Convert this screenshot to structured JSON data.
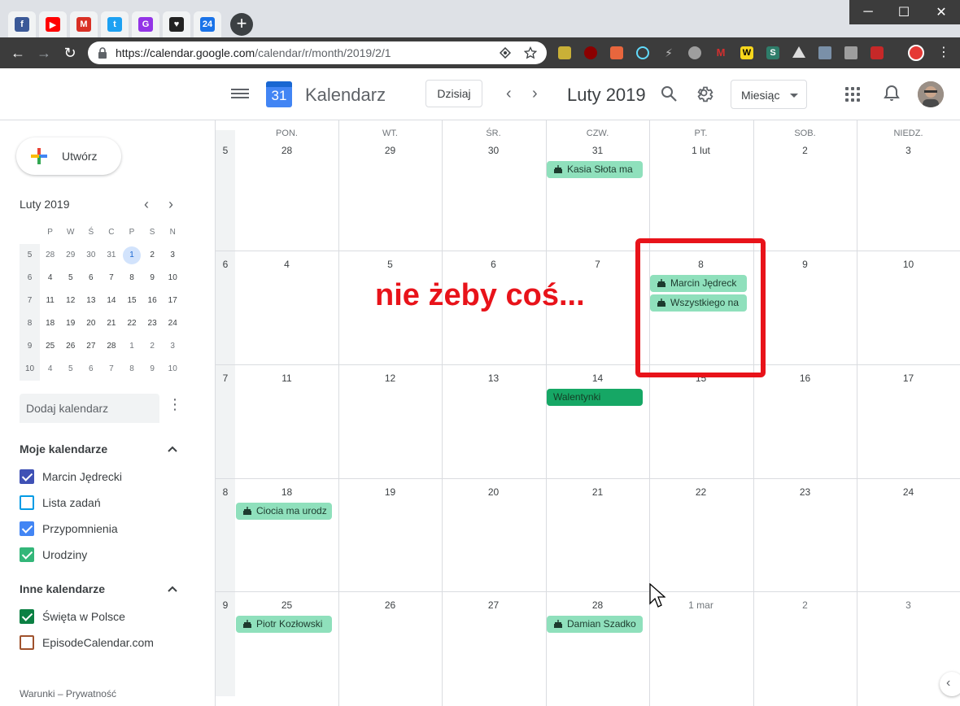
{
  "browser": {
    "tabs": [
      {
        "icon": "facebook-icon",
        "color": "#3b5998",
        "glyph": "f"
      },
      {
        "icon": "youtube-icon",
        "color": "#ff0000",
        "glyph": "▶"
      },
      {
        "icon": "gmail-icon",
        "color": "#d93025",
        "glyph": "M"
      },
      {
        "icon": "twitter-icon",
        "color": "#1da1f2",
        "glyph": "t"
      },
      {
        "icon": "grammarly-icon",
        "color": "#9334e6",
        "glyph": "G"
      },
      {
        "icon": "tv-icon",
        "color": "#222222",
        "glyph": "♥"
      },
      {
        "icon": "calendar-tab-icon",
        "color": "#1a73e8",
        "glyph": "24"
      }
    ],
    "url_host": "https://calendar.google.com",
    "url_path": "/calendar/r/month/2019/2/1"
  },
  "header": {
    "app_title": "Kalendarz",
    "logo_number": "31",
    "today_button": "Dzisiaj",
    "month_title": "Luty 2019",
    "view_select": "Miesiąc"
  },
  "sidebar": {
    "create_button": "Utwórz",
    "mini_title": "Luty 2019",
    "mini_weekdays": [
      "P",
      "W",
      "Ś",
      "C",
      "P",
      "S",
      "N"
    ],
    "mini_weeks": [
      {
        "wk": "5",
        "days": [
          [
            "28",
            true
          ],
          [
            "29",
            true
          ],
          [
            "30",
            true
          ],
          [
            "31",
            true
          ],
          [
            "1",
            false
          ],
          [
            "2",
            false
          ],
          [
            "3",
            false
          ]
        ]
      },
      {
        "wk": "6",
        "days": [
          [
            "4",
            false
          ],
          [
            "5",
            false
          ],
          [
            "6",
            false
          ],
          [
            "7",
            false
          ],
          [
            "8",
            false
          ],
          [
            "9",
            false
          ],
          [
            "10",
            false
          ]
        ]
      },
      {
        "wk": "7",
        "days": [
          [
            "11",
            false
          ],
          [
            "12",
            false
          ],
          [
            "13",
            false
          ],
          [
            "14",
            false
          ],
          [
            "15",
            false
          ],
          [
            "16",
            false
          ],
          [
            "17",
            false
          ]
        ]
      },
      {
        "wk": "8",
        "days": [
          [
            "18",
            false
          ],
          [
            "19",
            false
          ],
          [
            "20",
            false
          ],
          [
            "21",
            false
          ],
          [
            "22",
            false
          ],
          [
            "23",
            false
          ],
          [
            "24",
            false
          ]
        ]
      },
      {
        "wk": "9",
        "days": [
          [
            "25",
            false
          ],
          [
            "26",
            false
          ],
          [
            "27",
            false
          ],
          [
            "28",
            false
          ],
          [
            "1",
            true
          ],
          [
            "2",
            true
          ],
          [
            "3",
            true
          ]
        ]
      },
      {
        "wk": "10",
        "days": [
          [
            "4",
            true
          ],
          [
            "5",
            true
          ],
          [
            "6",
            true
          ],
          [
            "7",
            true
          ],
          [
            "8",
            true
          ],
          [
            "9",
            true
          ],
          [
            "10",
            true
          ]
        ]
      }
    ],
    "add_calendar_placeholder": "Dodaj kalendarz",
    "my_calendars_title": "Moje kalendarze",
    "my_calendars": [
      {
        "label": "Marcin Jędrecki",
        "color": "#3f51b5",
        "checked": true
      },
      {
        "label": "Lista zadań",
        "color": "#039be5",
        "checked": false
      },
      {
        "label": "Przypomnienia",
        "color": "#4285f4",
        "checked": true
      },
      {
        "label": "Urodziny",
        "color": "#33b679",
        "checked": true
      }
    ],
    "other_calendars_title": "Inne kalendarze",
    "other_calendars": [
      {
        "label": "Święta w Polsce",
        "color": "#0b8043",
        "checked": true
      },
      {
        "label": "EpisodeCalendar.com",
        "color": "#a0522d",
        "checked": false
      }
    ],
    "footer_terms": "Warunki",
    "footer_sep": " – ",
    "footer_privacy": "Prywatność"
  },
  "month": {
    "weekdays": [
      "PON.",
      "WT.",
      "ŚR.",
      "CZW.",
      "PT.",
      "SOB.",
      "NIEDZ."
    ],
    "weeks": [
      {
        "wk": "5",
        "days": [
          [
            "28",
            false
          ],
          [
            "29",
            false
          ],
          [
            "30",
            false
          ],
          [
            "31",
            false
          ],
          [
            "1 lut",
            false
          ],
          [
            "2",
            false
          ],
          [
            "3",
            false
          ]
        ]
      },
      {
        "wk": "6",
        "days": [
          [
            "4",
            false
          ],
          [
            "5",
            false
          ],
          [
            "6",
            false
          ],
          [
            "7",
            false
          ],
          [
            "8",
            false
          ],
          [
            "9",
            false
          ],
          [
            "10",
            false
          ]
        ]
      },
      {
        "wk": "7",
        "days": [
          [
            "11",
            false
          ],
          [
            "12",
            false
          ],
          [
            "13",
            false
          ],
          [
            "14",
            false
          ],
          [
            "15",
            false
          ],
          [
            "16",
            false
          ],
          [
            "17",
            false
          ]
        ]
      },
      {
        "wk": "8",
        "days": [
          [
            "18",
            false
          ],
          [
            "19",
            false
          ],
          [
            "20",
            false
          ],
          [
            "21",
            false
          ],
          [
            "22",
            false
          ],
          [
            "23",
            false
          ],
          [
            "24",
            false
          ]
        ]
      },
      {
        "wk": "9",
        "days": [
          [
            "25",
            false
          ],
          [
            "26",
            false
          ],
          [
            "27",
            false
          ],
          [
            "28",
            false
          ],
          [
            "1 mar",
            true
          ],
          [
            "2",
            true
          ],
          [
            "3",
            true
          ]
        ]
      }
    ],
    "events": [
      {
        "title": "Kasia Słota ma",
        "week": 0,
        "day": 3,
        "slot": 0,
        "kind": "birthday"
      },
      {
        "title": "Marcin Jędreck",
        "week": 1,
        "day": 4,
        "slot": 0,
        "kind": "birthday"
      },
      {
        "title": "Wszystkiego na",
        "week": 1,
        "day": 4,
        "slot": 1,
        "kind": "birthday"
      },
      {
        "title": "Walentynki",
        "week": 2,
        "day": 3,
        "slot": 0,
        "kind": "holiday"
      },
      {
        "title": "Ciocia ma urodz",
        "week": 3,
        "day": 0,
        "slot": 0,
        "kind": "birthday"
      },
      {
        "title": "Piotr Kozłowski",
        "week": 4,
        "day": 0,
        "slot": 0,
        "kind": "birthday"
      },
      {
        "title": "Damian Szadko",
        "week": 4,
        "day": 3,
        "slot": 0,
        "kind": "birthday"
      }
    ]
  },
  "annotation": {
    "text": "nie żeby coś...",
    "color": "#e8131a"
  },
  "colors": {
    "birthday_event": "#8fe0bc",
    "holiday_event": "#16a765",
    "accent": "#1a73e8"
  }
}
